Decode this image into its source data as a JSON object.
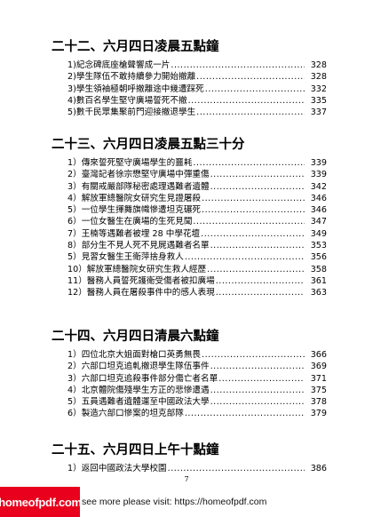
{
  "sections": [
    {
      "title": "二十二、六月四日凌晨五點鐘",
      "entries": [
        {
          "text": "1)紀念碑底座槍聲響成一片",
          "page": "328"
        },
        {
          "text": "2)學生隊伍不敢持續參力開始撤離",
          "page": "328"
        },
        {
          "text": "3)學生領袖極朝呼撤離途中幾遭踩死",
          "page": "332"
        },
        {
          "text": "4)數百名學生堅守廣場誓死不撤",
          "page": "335"
        },
        {
          "text": "5)數千民眾集聚前門迎接撤退學生",
          "page": "337"
        }
      ]
    },
    {
      "title": "二十三、六月四日凌晨五點三十分",
      "entries": [
        {
          "text": "1）傳來誓死堅守廣場學生的噩耗",
          "page": "339"
        },
        {
          "text": "2）臺灣記者徐宗懋堅守廣場中彈重傷",
          "page": "339"
        },
        {
          "text": "3）有關戒嚴部隊秘密處理遇難者遺體",
          "page": "342"
        },
        {
          "text": "4）解放軍總醫院女研究生見證屠殺",
          "page": "346"
        },
        {
          "text": "5）一位學生揮舞旗幟慘遭坦克碾死",
          "page": "346"
        },
        {
          "text": "6）一位女醫生在廣場的生死見聞",
          "page": "347"
        },
        {
          "text": "7）王楠等遇難者被埋 28 中學花壇",
          "page": "349"
        },
        {
          "text": "8）部分生不見人死不見屍遇難者名單",
          "page": "353"
        },
        {
          "text": "5）見習女醫生王衛萍捨身救人",
          "page": "356"
        },
        {
          "text": "10）解放軍總醫院女研究生救人經歷",
          "page": "358"
        },
        {
          "text": "11）醫務人員誓死護衛受傷者被扣廣場",
          "page": "361"
        },
        {
          "text": "12）醫務人員在屠殺事件中的感人表現",
          "page": "363"
        }
      ]
    },
    {
      "title": "二十四、六月四日清晨六點鐘",
      "entries": [
        {
          "text": "1）四位北京大姐面對槍口英勇無畏",
          "page": "366"
        },
        {
          "text": "2）六部口坦克追軋撤退學生隊伍事件",
          "page": "369"
        },
        {
          "text": "3）六部口坦克追殺事件部分傷亡者名單",
          "page": "371"
        },
        {
          "text": "4）北京體院傷殘學生方正的悲慘遭遇",
          "page": "375"
        },
        {
          "text": "5）五員遇難者遺體運至中國政法大學",
          "page": "378"
        },
        {
          "text": "6）製造六部口慘案的坦克部隊",
          "page": "379"
        }
      ]
    },
    {
      "title": "二十五、六月四日上午十點鐘",
      "entries": [
        {
          "text": "1）返回中國政法大學校園",
          "page": "386"
        }
      ]
    }
  ],
  "page_number": "7",
  "footer": {
    "text": "see more please visit: https://homeofpdf.com",
    "watermark": "homeofpdf.com"
  }
}
